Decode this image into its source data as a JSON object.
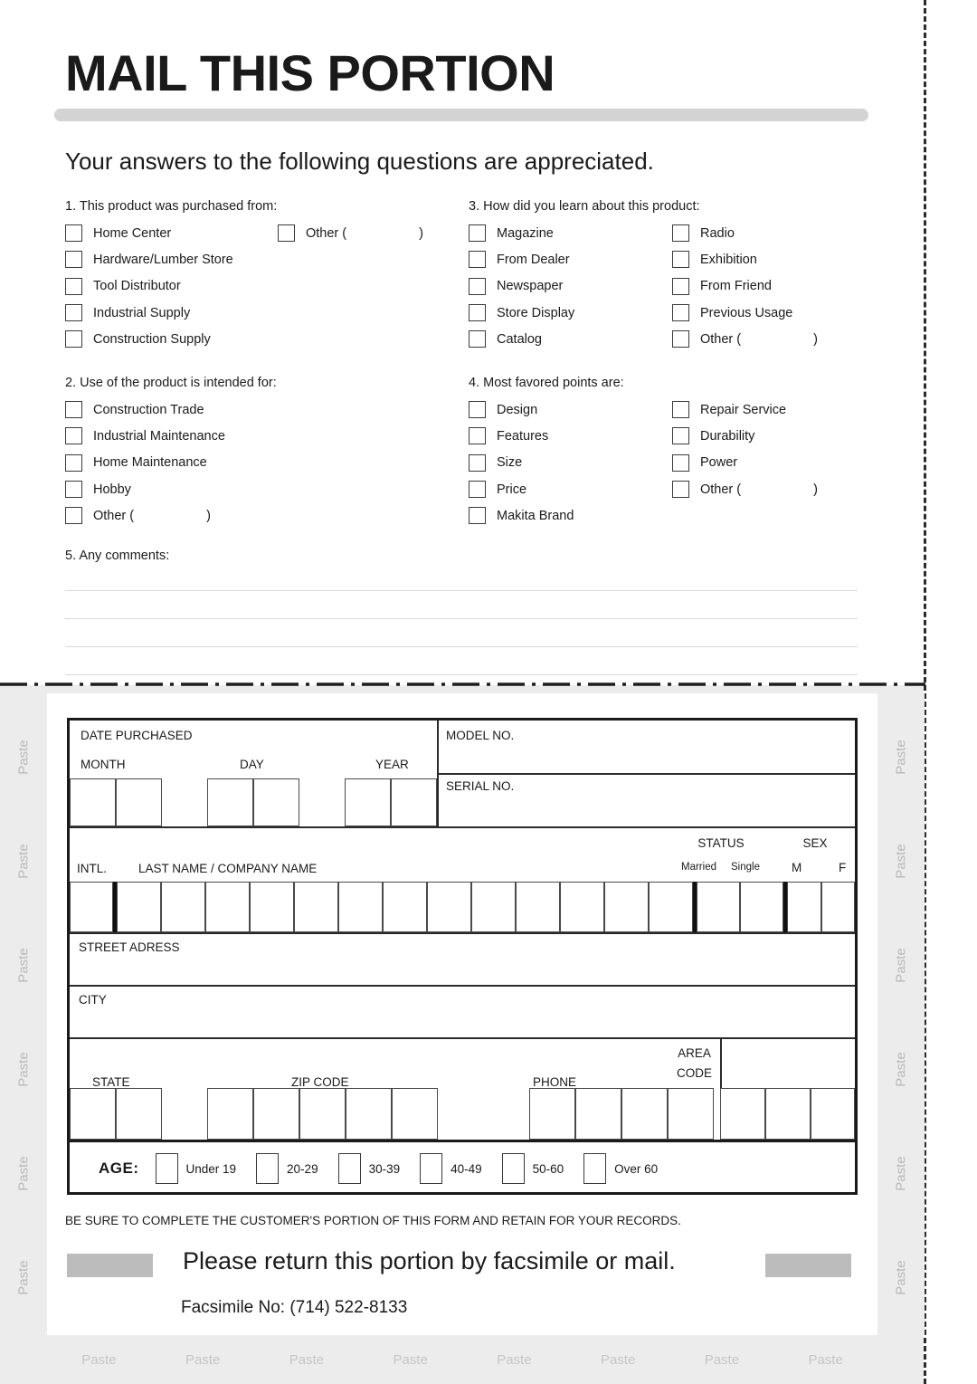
{
  "header": {
    "title": "MAIL THIS PORTION",
    "subtitle": "Your answers to the following questions are appreciated."
  },
  "questions": [
    {
      "id": "q1",
      "heading": "1. This product was purchased from:",
      "columns": [
        [
          "Home Center",
          "Hardware/Lumber Store",
          "Tool Distributor",
          "Industrial Supply",
          "Construction Supply"
        ],
        [
          "Other ("
        ]
      ],
      "other_close": ")"
    },
    {
      "id": "q3",
      "heading": "3. How did you learn about this product:",
      "columns": [
        [
          "Magazine",
          "From Dealer",
          "Newspaper",
          "Store Display",
          "Catalog"
        ],
        [
          "Radio",
          "Exhibition",
          "From Friend",
          "Previous Usage",
          "Other ("
        ]
      ],
      "other_close": ")"
    },
    {
      "id": "q2",
      "heading": "2. Use of the product is intended for:",
      "columns": [
        [
          "Construction Trade",
          "Industrial Maintenance",
          "Home Maintenance",
          "Hobby",
          "Other ("
        ]
      ],
      "other_close": ")"
    },
    {
      "id": "q4",
      "heading": "4. Most favored points are:",
      "columns": [
        [
          "Design",
          "Features",
          "Size",
          "Price",
          "Makita Brand"
        ],
        [
          "Repair Service",
          "Durability",
          "Power",
          "Other ("
        ]
      ],
      "other_close": ")"
    }
  ],
  "comments": {
    "heading": "5. Any comments:",
    "line_count": 4
  },
  "customer_form": {
    "date_purchased_label": "DATE PURCHASED",
    "month_label": "MONTH",
    "day_label": "DAY",
    "year_label": "YEAR",
    "model_no_label": "MODEL NO.",
    "serial_no_label": "SERIAL NO.",
    "intl_label": "INTL.",
    "name_label": "LAST NAME / COMPANY NAME",
    "status_label": "STATUS",
    "married_label": "Married",
    "single_label": "Single",
    "sex_label": "SEX",
    "male_label": "M",
    "female_label": "F",
    "street_label": "STREET ADRESS",
    "city_label": "CITY",
    "state_label": "STATE",
    "zip_label": "ZIP CODE",
    "phone_label": "PHONE",
    "area_code_label_1": "AREA",
    "area_code_label_2": "CODE",
    "age_label": "AGE:",
    "age_options": [
      "Under 19",
      "20-29",
      "30-39",
      "40-49",
      "50-60",
      "Over 60"
    ],
    "month_cells": 2,
    "day_cells": 2,
    "year_cells": 2,
    "name_cells": 13,
    "status_cells": 2,
    "sex_cells": 2,
    "state_cells": 2,
    "zip_cells": 5,
    "phone_cells": 4,
    "area_cells": 3
  },
  "footer": {
    "note": "BE SURE TO COMPLETE THE CUSTOMER'S PORTION OF THIS FORM AND RETAIN FOR YOUR RECORDS.",
    "return_text": "Please return this portion by facsimile or mail.",
    "fax_line": "Facsimile No: (714) 522-8133"
  },
  "paste": {
    "label": "Paste",
    "left_count": 6,
    "right_count": 6,
    "bottom_count": 8
  },
  "colors": {
    "title_bar": "#d3d3d3",
    "grey_block": "#bcbcbc",
    "panel_bg": "#ececec",
    "ink": "#1a1a1a"
  }
}
